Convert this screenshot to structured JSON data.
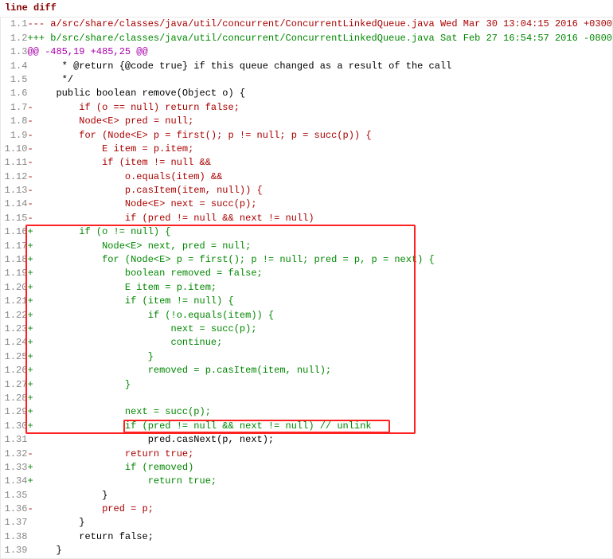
{
  "title": "line diff",
  "lines": [
    {
      "n": "1.1",
      "cls": "rm-header",
      "text": "--- a/src/share/classes/java/util/concurrent/ConcurrentLinkedQueue.java Wed Mar 30 13:04:15 2016 +0300"
    },
    {
      "n": "1.2",
      "cls": "ad-header",
      "text": "+++ b/src/share/classes/java/util/concurrent/ConcurrentLinkedQueue.java Sat Feb 27 16:54:57 2016 -0800"
    },
    {
      "n": "1.3",
      "cls": "hunk",
      "text": "@@ -485,19 +485,25 @@"
    },
    {
      "n": "1.4",
      "cls": "ctx",
      "text": "      * @return {@code true} if this queue changed as a result of the call"
    },
    {
      "n": "1.5",
      "cls": "ctx",
      "text": "      */"
    },
    {
      "n": "1.6",
      "cls": "ctx",
      "text": "     public boolean remove(Object o) {"
    },
    {
      "n": "1.7",
      "cls": "removed",
      "text": "-        if (o == null) return false;"
    },
    {
      "n": "1.8",
      "cls": "removed",
      "text": "-        Node<E> pred = null;"
    },
    {
      "n": "1.9",
      "cls": "removed",
      "text": "-        for (Node<E> p = first(); p != null; p = succ(p)) {"
    },
    {
      "n": "1.10",
      "cls": "removed",
      "text": "-            E item = p.item;"
    },
    {
      "n": "1.11",
      "cls": "removed",
      "text": "-            if (item != null &&"
    },
    {
      "n": "1.12",
      "cls": "removed",
      "text": "-                o.equals(item) &&"
    },
    {
      "n": "1.13",
      "cls": "removed",
      "text": "-                p.casItem(item, null)) {"
    },
    {
      "n": "1.14",
      "cls": "removed",
      "text": "-                Node<E> next = succ(p);"
    },
    {
      "n": "1.15",
      "cls": "removed",
      "text": "-                if (pred != null && next != null)"
    },
    {
      "n": "1.16",
      "cls": "added",
      "text": "+        if (o != null) {"
    },
    {
      "n": "1.17",
      "cls": "added",
      "text": "+            Node<E> next, pred = null;"
    },
    {
      "n": "1.18",
      "cls": "added",
      "text": "+            for (Node<E> p = first(); p != null; pred = p, p = next) {"
    },
    {
      "n": "1.19",
      "cls": "added",
      "text": "+                boolean removed = false;"
    },
    {
      "n": "1.20",
      "cls": "added",
      "text": "+                E item = p.item;"
    },
    {
      "n": "1.21",
      "cls": "added",
      "text": "+                if (item != null) {"
    },
    {
      "n": "1.22",
      "cls": "added",
      "text": "+                    if (!o.equals(item)) {"
    },
    {
      "n": "1.23",
      "cls": "added",
      "text": "+                        next = succ(p);"
    },
    {
      "n": "1.24",
      "cls": "added",
      "text": "+                        continue;"
    },
    {
      "n": "1.25",
      "cls": "added",
      "text": "+                    }"
    },
    {
      "n": "1.26",
      "cls": "added",
      "text": "+                    removed = p.casItem(item, null);"
    },
    {
      "n": "1.27",
      "cls": "added",
      "text": "+                }"
    },
    {
      "n": "1.28",
      "cls": "added",
      "text": "+"
    },
    {
      "n": "1.29",
      "cls": "added",
      "text": "+                next = succ(p);"
    },
    {
      "n": "1.30",
      "cls": "added",
      "text": "+                if (pred != null && next != null) // unlink"
    },
    {
      "n": "1.31",
      "cls": "ctx",
      "text": "                     pred.casNext(p, next);"
    },
    {
      "n": "1.32",
      "cls": "removed",
      "text": "-                return true;"
    },
    {
      "n": "1.33",
      "cls": "added",
      "text": "+                if (removed)"
    },
    {
      "n": "1.34",
      "cls": "added",
      "text": "+                    return true;"
    },
    {
      "n": "1.35",
      "cls": "ctx",
      "text": "             }"
    },
    {
      "n": "1.36",
      "cls": "removed",
      "text": "-            pred = p;"
    },
    {
      "n": "1.37",
      "cls": "ctx",
      "text": "         }"
    },
    {
      "n": "1.38",
      "cls": "ctx",
      "text": "         return false;"
    },
    {
      "n": "1.39",
      "cls": "ctx",
      "text": "     }"
    }
  ],
  "highlight": {
    "fromLine": "1.16",
    "toLine": "1.30"
  },
  "innerHighlight": {
    "line": "1.30",
    "leftChars": 17,
    "widthChars": 46
  }
}
